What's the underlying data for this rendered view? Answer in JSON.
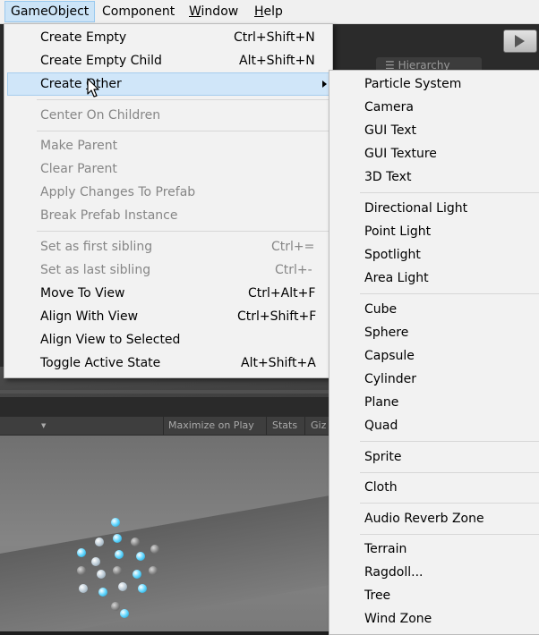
{
  "menubar": {
    "items": [
      {
        "label": "GameObject"
      },
      {
        "label": "Component"
      },
      {
        "label_pre": "",
        "label_ul": "W",
        "label_post": "indow"
      },
      {
        "label_pre": "",
        "label_ul": "H",
        "label_post": "elp"
      }
    ]
  },
  "background": {
    "hierarchy_tab": "☰ Hierarchy",
    "game_toolbar": {
      "maximize_on_play": "Maximize on Play",
      "stats": "Stats",
      "gizmos": "Giz"
    }
  },
  "gameobject_menu": {
    "items": [
      {
        "label": "Create Empty",
        "shortcut": "Ctrl+Shift+N"
      },
      {
        "label": "Create Empty Child",
        "shortcut": "Alt+Shift+N"
      },
      {
        "label_pre": "Create ",
        "label_ul": "O",
        "label_post": "ther"
      },
      {
        "label": "Center On Children"
      },
      {
        "label": "Make Parent"
      },
      {
        "label": "Clear Parent"
      },
      {
        "label": "Apply Changes To Prefab"
      },
      {
        "label": "Break Prefab Instance"
      },
      {
        "label": "Set as first sibling",
        "shortcut": "Ctrl+="
      },
      {
        "label": "Set as last sibling",
        "shortcut": "Ctrl+-"
      },
      {
        "label": "Move To View",
        "shortcut": "Ctrl+Alt+F"
      },
      {
        "label": "Align With View",
        "shortcut": "Ctrl+Shift+F"
      },
      {
        "label": "Align View to Selected"
      },
      {
        "label": "Toggle Active State",
        "shortcut": "Alt+Shift+A"
      }
    ]
  },
  "create_other_menu": {
    "items": [
      {
        "label": "Particle System"
      },
      {
        "label": "Camera"
      },
      {
        "label": "GUI Text"
      },
      {
        "label": "GUI Texture"
      },
      {
        "label": "3D Text"
      },
      {
        "label": "Directional Light"
      },
      {
        "label": "Point Light"
      },
      {
        "label": "Spotlight"
      },
      {
        "label": "Area Light"
      },
      {
        "label": "Cube"
      },
      {
        "label": "Sphere"
      },
      {
        "label": "Capsule"
      },
      {
        "label": "Cylinder"
      },
      {
        "label": "Plane"
      },
      {
        "label": "Quad"
      },
      {
        "label": "Sprite"
      },
      {
        "label": "Cloth"
      },
      {
        "label": "Audio Reverb Zone"
      },
      {
        "label": "Terrain"
      },
      {
        "label": "Ragdoll..."
      },
      {
        "label": "Tree"
      },
      {
        "label": "Wind Zone"
      }
    ]
  }
}
